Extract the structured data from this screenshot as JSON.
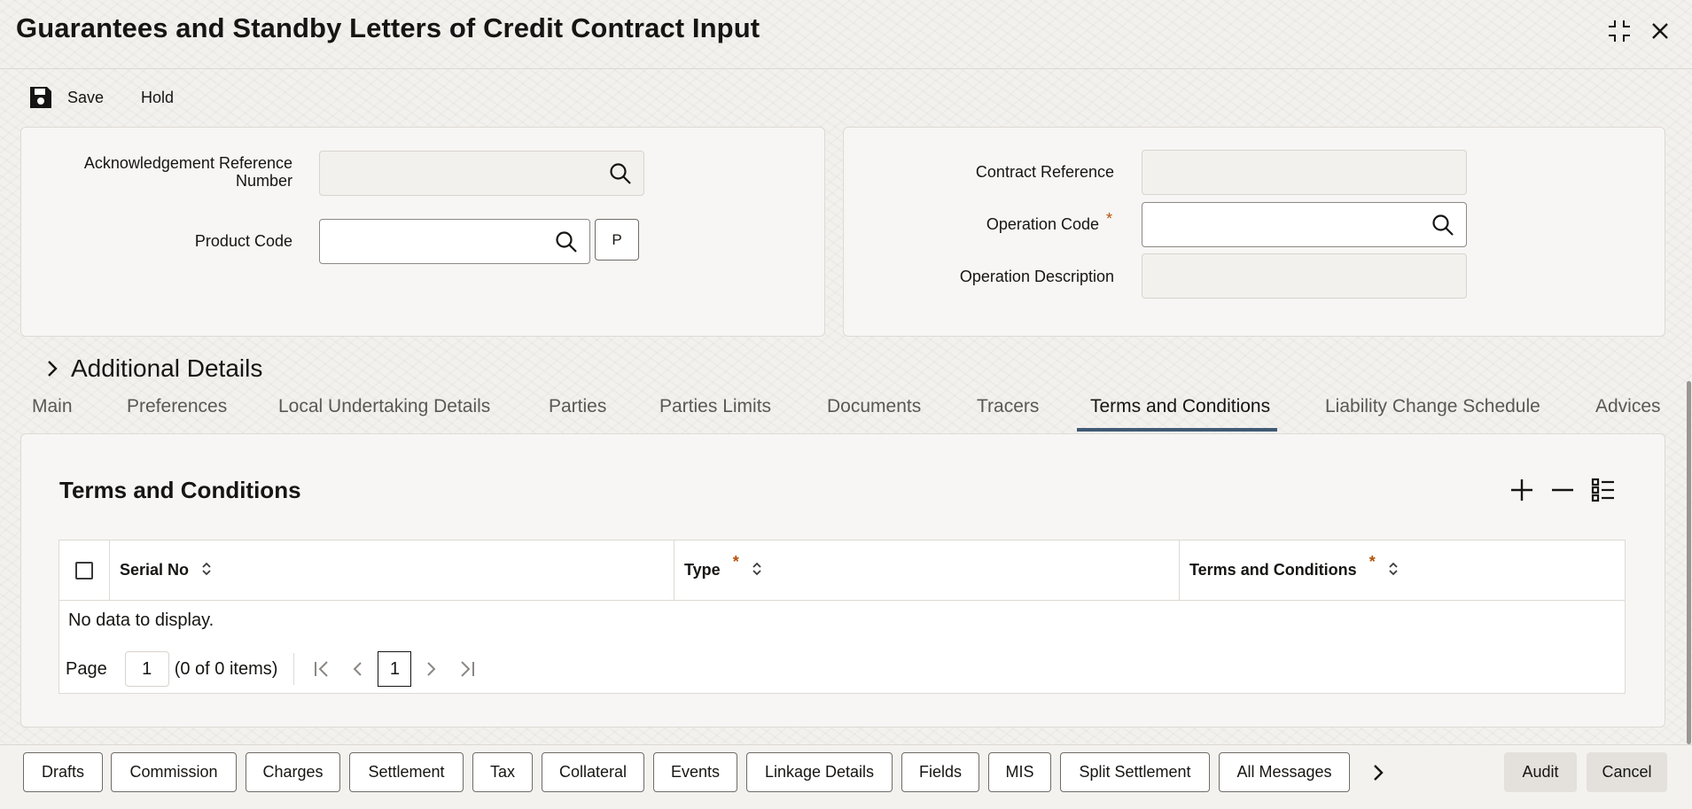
{
  "window": {
    "title": "Guarantees and Standby Letters of Credit Contract Input"
  },
  "toolbar": {
    "save_label": "Save",
    "hold_label": "Hold"
  },
  "left_panel": {
    "ack_ref_label": "Acknowledgement Reference Number",
    "ack_ref_value": "",
    "product_code_label": "Product Code",
    "product_code_value": "",
    "p_button": "P"
  },
  "right_panel": {
    "contract_ref_label": "Contract Reference",
    "contract_ref_value": "",
    "operation_code_label": "Operation Code",
    "operation_code_value": "",
    "operation_desc_label": "Operation Description",
    "operation_desc_value": "",
    "required_mark": "*"
  },
  "additional_details": "Additional Details",
  "tabs": [
    {
      "label": "Main"
    },
    {
      "label": "Preferences"
    },
    {
      "label": "Local Undertaking Details"
    },
    {
      "label": "Parties"
    },
    {
      "label": "Parties Limits"
    },
    {
      "label": "Documents"
    },
    {
      "label": "Tracers"
    },
    {
      "label": "Terms and Conditions",
      "active": true
    },
    {
      "label": "Liability Change Schedule"
    },
    {
      "label": "Advices"
    }
  ],
  "terms": {
    "title": "Terms and Conditions",
    "columns": [
      "Serial No",
      "Type",
      "Terms and Conditions"
    ],
    "required_mark": "*",
    "empty_text": "No data to display.",
    "pager": {
      "page_label": "Page",
      "page_value": "1",
      "items_text": "(0 of 0 items)",
      "current_page": "1"
    }
  },
  "bottom_buttons": [
    "Drafts",
    "Commission",
    "Charges",
    "Settlement",
    "Tax",
    "Collateral",
    "Events",
    "Linkage Details",
    "Fields",
    "MIS",
    "Split Settlement",
    "All Messages"
  ],
  "footer_actions": {
    "audit": "Audit",
    "cancel": "Cancel"
  },
  "colors": {
    "accent_underline": "#3f5a73",
    "required": "#b45309"
  }
}
